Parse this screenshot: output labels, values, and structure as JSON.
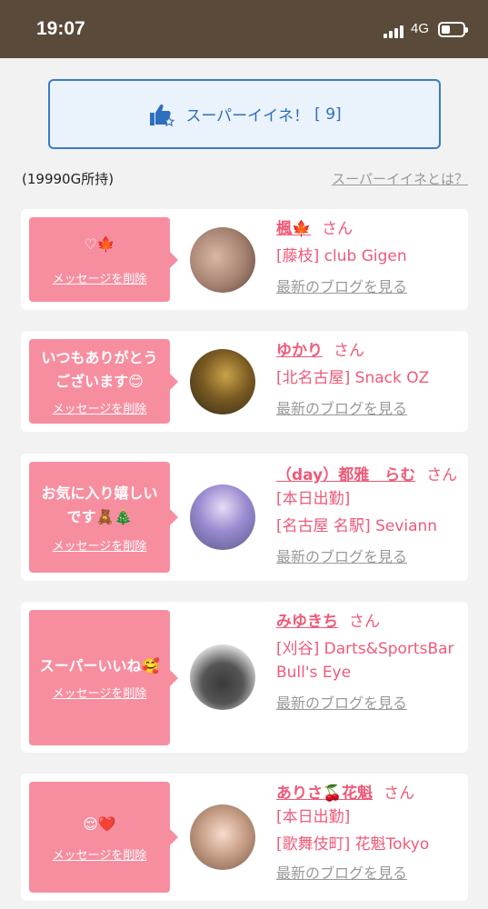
{
  "status": {
    "time": "19:07",
    "network": "4G"
  },
  "super_like": {
    "label": "スーパーイイネ！",
    "count": "[ 9]"
  },
  "owned": "(19990G所持)",
  "about": "スーパーイイネとは？",
  "cards": [
    {
      "message": "♡🍁",
      "delete": "メッセージを削除",
      "name": "楓🍁",
      "san": "さん",
      "store": "[藤枝] club Gigen",
      "blog": "最新のブログを見る"
    },
    {
      "message": "いつもありがとうございます😊",
      "delete": "メッセージを削除",
      "name": "ゆかり",
      "san": "さん",
      "store": "[北名古屋] Snack OZ",
      "blog": "最新のブログを見る"
    },
    {
      "message": "お気に入り嬉しいです🧸🎄",
      "delete": "メッセージを削除",
      "name": "（day）都雅　らむ",
      "san": "さん",
      "note": "[本日出勤]",
      "store": "[名古屋 名駅] Seviann",
      "blog": "最新のブログを見る"
    },
    {
      "message": "スーパーいいね🥰",
      "delete": "メッセージを削除",
      "name": "みゆきち",
      "san": "さん",
      "store": "[刈谷] Darts&SportsBar Bull's Eye",
      "blog": "最新のブログを見る"
    },
    {
      "message": "😌❤️",
      "delete": "メッセージを削除",
      "name": "ありさ🍒花魁",
      "san": "さん",
      "note": "[本日出勤]",
      "store": "[歌舞伎町] 花魁Tokyo",
      "blog": "最新のブログを見る"
    }
  ]
}
